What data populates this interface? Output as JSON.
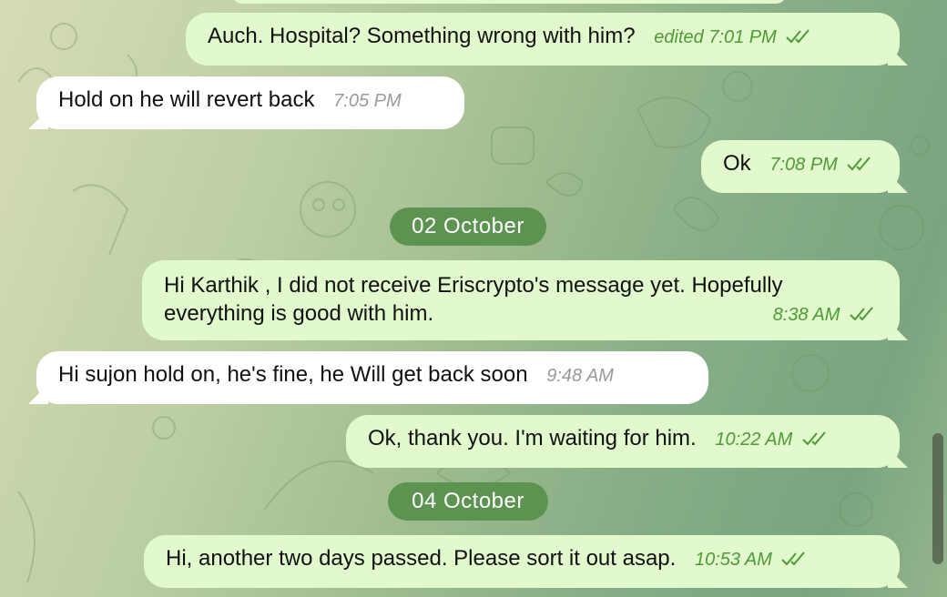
{
  "messages": [
    {
      "id": "m1",
      "dir": "out",
      "text": "Auch. Hospital? Something wrong with him?",
      "edited": "edited",
      "time": "7:01 PM",
      "read": true
    },
    {
      "id": "m2",
      "dir": "in",
      "text": "Hold on he will revert back",
      "time": "7:05 PM"
    },
    {
      "id": "m3",
      "dir": "out",
      "text": "Ok",
      "time": "7:08 PM",
      "read": true
    },
    {
      "id": "m4",
      "dir": "out",
      "text": "Hi Karthik , I did not receive Eriscrypto's message yet. Hopefully everything is good with him.",
      "time": "8:38 AM",
      "read": true
    },
    {
      "id": "m5",
      "dir": "in",
      "text": "Hi sujon hold on, he's fine, he Will get back soon",
      "time": "9:48 AM"
    },
    {
      "id": "m6",
      "dir": "out",
      "text": "Ok, thank you. I'm waiting for him.",
      "time": "10:22 AM",
      "read": true
    },
    {
      "id": "m7",
      "dir": "out",
      "text": "Hi, another two days passed. Please sort it out asap.",
      "time": "10:53 AM",
      "read": true
    }
  ],
  "dates": {
    "d1": "02 October",
    "d2": "04 October"
  },
  "colors": {
    "outgoing": "#e2f8cd",
    "incoming": "#ffffff",
    "meta_out": "#4e9a37",
    "date_pill": "#5c9351"
  },
  "icons": {
    "read": "double-check-icon"
  }
}
